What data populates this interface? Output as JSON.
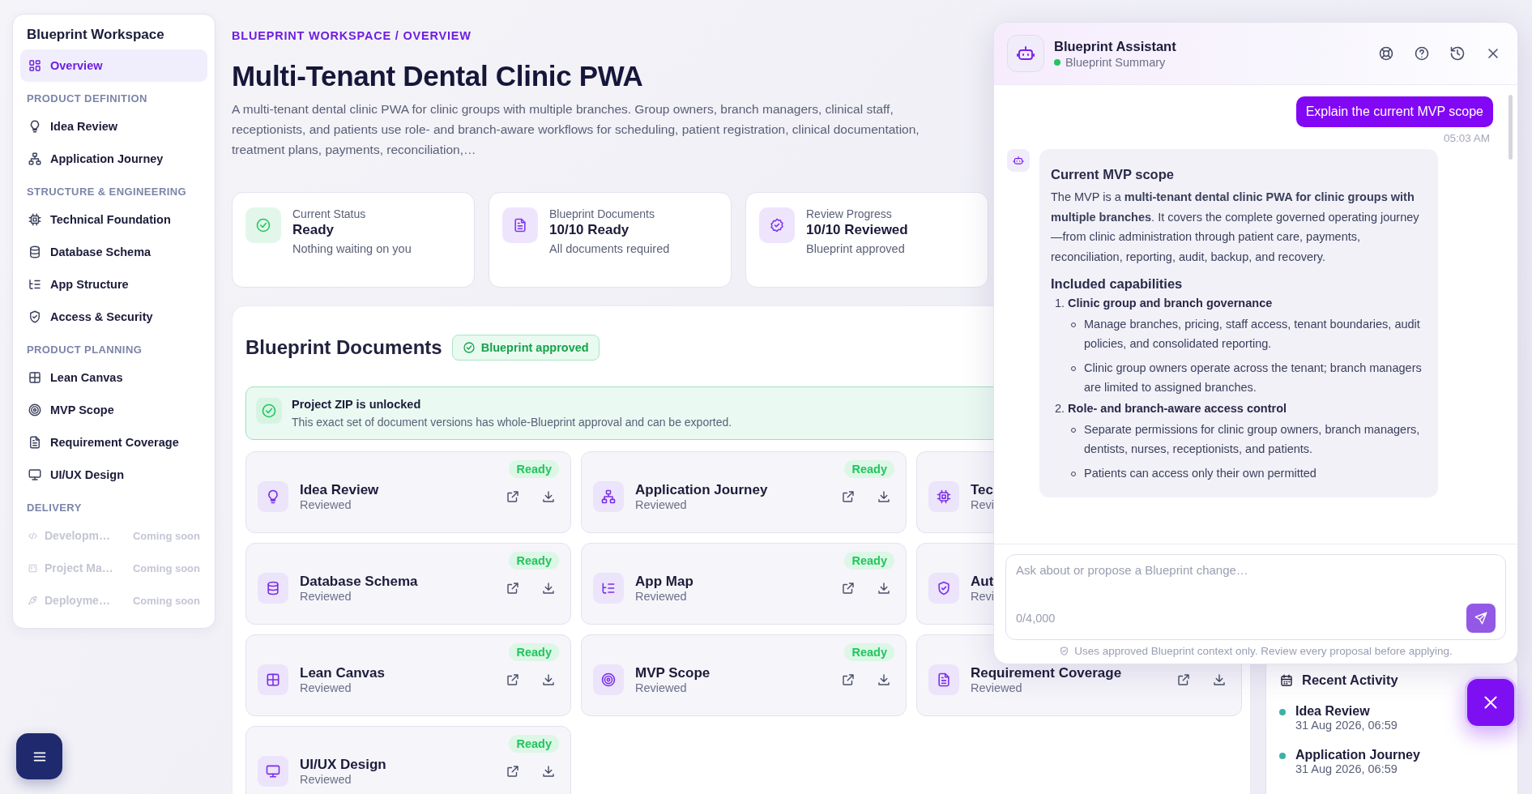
{
  "sidebar": {
    "title": "Blueprint Workspace",
    "sections": [
      {
        "items": [
          {
            "label": "Overview",
            "selected": true,
            "disabled": false
          }
        ]
      },
      {
        "heading": "PRODUCT DEFINITION",
        "items": [
          {
            "label": "Idea Review",
            "selected": false,
            "disabled": false
          },
          {
            "label": "Application Journey",
            "selected": false,
            "disabled": false
          }
        ]
      },
      {
        "heading": "STRUCTURE & ENGINEERING",
        "items": [
          {
            "label": "Technical Foundation",
            "selected": false,
            "disabled": false
          },
          {
            "label": "Database Schema",
            "selected": false,
            "disabled": false
          },
          {
            "label": "App Structure",
            "selected": false,
            "disabled": false
          },
          {
            "label": "Access & Security",
            "selected": false,
            "disabled": false
          }
        ]
      },
      {
        "heading": "PRODUCT PLANNING",
        "items": [
          {
            "label": "Lean Canvas",
            "selected": false,
            "disabled": false
          },
          {
            "label": "MVP Scope",
            "selected": false,
            "disabled": false
          },
          {
            "label": "Requirement Coverage",
            "selected": false,
            "disabled": false
          },
          {
            "label": "UI/UX Design",
            "selected": false,
            "disabled": false
          }
        ]
      },
      {
        "heading": "DELIVERY",
        "items": [
          {
            "label": "Developm…",
            "note": "Coming soon",
            "selected": false,
            "disabled": true
          },
          {
            "label": "Project Ma…",
            "note": "Coming soon",
            "selected": false,
            "disabled": true
          },
          {
            "label": "Deployme…",
            "note": "Coming soon",
            "selected": false,
            "disabled": true
          }
        ]
      }
    ]
  },
  "breadcrumb": "BLUEPRINT WORKSPACE / OVERVIEW",
  "title": "Multi-Tenant Dental Clinic PWA",
  "description": "A multi-tenant dental clinic PWA for clinic groups with multiple branches. Group owners, branch managers, clinical staff, receptionists, and patients use role- and branch-aware workflows for scheduling, patient registration, clinical documentation, treatment plans, payments, reconciliation,…",
  "stats": [
    {
      "label": "Current Status",
      "value": "Ready",
      "note": "Nothing waiting on you",
      "color": "#22c55e"
    },
    {
      "label": "Blueprint Documents",
      "value": "10/10 Ready",
      "note": "All documents required",
      "color": "#7c3aed"
    },
    {
      "label": "Review Progress",
      "value": "10/10 Reviewed",
      "note": "Blueprint approved",
      "color": "#7c3aed"
    }
  ],
  "documents": {
    "title": "Blueprint Documents",
    "badge": "Blueprint approved",
    "banner": {
      "title": "Project ZIP is unlocked",
      "text": "This exact set of document versions has whole-Blueprint approval and can be exported."
    },
    "cards": [
      {
        "title": "Idea Review",
        "status": "Reviewed",
        "badge": "Ready",
        "actions": true
      },
      {
        "title": "Application Journey",
        "status": "Reviewed",
        "badge": "Ready",
        "actions": true
      },
      {
        "title": "Tec",
        "status": "Revi",
        "actions": false
      },
      {
        "title": "Database Schema",
        "status": "Reviewed",
        "badge": "Ready",
        "actions": true
      },
      {
        "title": "App Map",
        "status": "Reviewed",
        "badge": "Ready",
        "actions": true
      },
      {
        "title": "Aut",
        "status": "Revi",
        "actions": false
      },
      {
        "title": "Lean Canvas",
        "status": "Reviewed",
        "badge": "Ready",
        "actions": true
      },
      {
        "title": "MVP Scope",
        "status": "Reviewed",
        "badge": "Ready",
        "actions": true
      },
      {
        "title": "Requirement Coverage",
        "status": "Reviewed",
        "actions": true
      },
      {
        "title": "UI/UX Design",
        "status": "Reviewed",
        "badge": "Ready",
        "actions": true
      }
    ]
  },
  "recent_activity": {
    "title": "Recent Activity",
    "items": [
      {
        "title": "Idea Review",
        "time": "31 Aug 2026, 06:59"
      },
      {
        "title": "Application Journey",
        "time": "31 Aug 2026, 06:59"
      }
    ]
  },
  "assistant": {
    "title": "Blueprint Assistant",
    "subtitle": "Blueprint Summary",
    "online": true,
    "messages": [
      {
        "kind": "user",
        "text": "Explain the current MVP scope",
        "time": "05:03 AM"
      },
      {
        "kind": "assistant",
        "blocks": [
          {
            "kind": "heading",
            "text": "Current MVP scope"
          },
          {
            "kind": "paragraph",
            "text": "The MVP is a **multi-tenant dental clinic PWA for clinic groups with multiple branches**. It covers the complete governed operating journey—from clinic administration through patient care, payments, reconciliation, reporting, audit, backup, and recovery."
          },
          {
            "kind": "heading",
            "text": "Included capabilities"
          },
          {
            "kind": "numbered",
            "marker": "1.",
            "text": "Clinic group and branch governance",
            "children": [
              {
                "text": "Manage branches, pricing, staff access, tenant boundaries, audit policies, and consolidated reporting."
              },
              {
                "text": "Clinic group owners operate across the tenant; branch managers are limited to assigned branches."
              }
            ]
          },
          {
            "kind": "numbered",
            "marker": "2.",
            "text": "Role- and branch-aware access control",
            "children": [
              {
                "text": "Separate permissions for clinic group owners, branch managers, dentists, nurses, receptionists, and patients."
              },
              {
                "text": "Patients can access only their own permitted"
              }
            ]
          }
        ]
      }
    ],
    "input": {
      "placeholder": "Ask about or propose a Blueprint change…",
      "counter": "0/4,000"
    },
    "note": "Uses approved Blueprint context only. Review every proposal before applying."
  }
}
